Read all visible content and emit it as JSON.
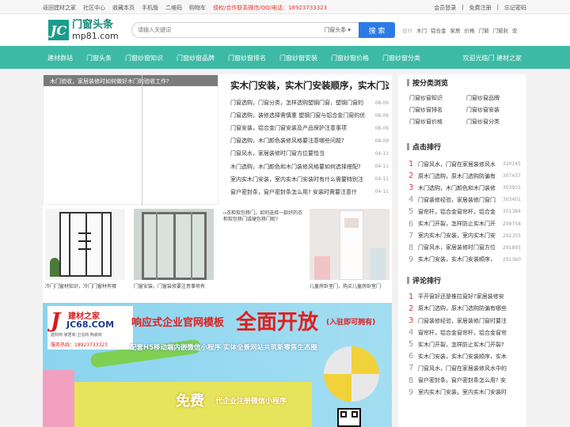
{
  "topbar": {
    "left_links": [
      "返回建材之家",
      "社区中心",
      "收藏本页",
      "手机版",
      "二维码",
      "购物车"
    ],
    "hotline": "侵权/合作联系微信/QQ/电话：18923733323",
    "right_links": [
      "会员登录",
      "免费注册",
      "忘记密码"
    ]
  },
  "header": {
    "logo_letter": "JC",
    "logo_title": "门窗头条",
    "logo_domain": "mp81.com",
    "search_placeholder": "请输入关键词",
    "search_category": "门窗头条",
    "search_button": "搜 索",
    "hot_links": [
      "建材",
      "木门",
      "铝合金",
      "家居",
      "价格",
      "门窗",
      "门窗封",
      "安"
    ]
  },
  "nav": {
    "items": [
      "建材群站",
      "门窗头条",
      "门窗纱窗知识",
      "门窗纱窗品牌",
      "门窗纱窗排名",
      "门窗纱窗安装",
      "门窗纱窗价格",
      "门窗纱窗分类"
    ],
    "welcome": "欢迎光临门 建材之家"
  },
  "slider": {
    "caption": "木门验收，家居装修时如何做好木门的验收工作?"
  },
  "news": {
    "headline": "实木门安装，实木门安装顺序，实木门选",
    "items": [
      {
        "title": "门窗选购，门窗分类，怎样选购塑钢门窗，塑钢门窗的",
        "date": "08-09"
      },
      {
        "title": "门窗选购，装修选择需慎重 塑钢门窗与铝合金门窗的优",
        "date": "08-09"
      },
      {
        "title": "门窗安装，铝合金门窗安装及产品保护注意事项",
        "date": "08-09"
      },
      {
        "title": "门窗选购，木门颜色装修风格要注意哪些问题?",
        "date": "08-09"
      },
      {
        "title": "门窗风水，家居装修时门窗方位要恰当",
        "date": "04-11"
      },
      {
        "title": "木门选购，木门颜色和木门装修风格要如何选择搭配?",
        "date": "04-11"
      },
      {
        "title": "室内实木门安装，室内实木门安装时有什么需要特别注",
        "date": "04-11"
      },
      {
        "title": "窗户密封条，窗户密封条怎么用? 安装时需要注意什",
        "date": "04-11"
      }
    ]
  },
  "thumbs": [
    {
      "caption": "冷门门窗材知识，冷门门窗材有哪"
    },
    {
      "caption": "门窗安装，门窗装修要注意事项有"
    },
    {
      "caption": "衣柜软包移门，如何选择一款好的衣柜软包移门?",
      "alt": "衣柜软包移门，如何选择一款好的衣柜软包移门或硬包移门呢?"
    },
    {
      "caption": "儿童房卧室门，购买儿童房卧室门"
    }
  ],
  "banner": {
    "brand": "建材之家",
    "brand_domain": "JC68.COM",
    "brand_sub": "建材商·家居商·卫浴商·陶瓷商",
    "brand_phone": "服务热线：18923733323",
    "headline_left": "响应式企业官网模板",
    "headline_main": "全面开放",
    "headline_tag": "(入驻即可拥有)",
    "subline": "配套H5移动端内嵌微信小程序 实体全景网站共筑新零售生态圈",
    "free_big": "免费",
    "free_text": "代企业注册微信小程序"
  },
  "sidebar": {
    "cat_title": "按分类浏览",
    "categories": [
      "门窗纱窗知识",
      "门窗纱窗品牌",
      "门窗纱窗排名",
      "门窗纱窗安装",
      "门窗纱窗价格",
      "门窗纱窗分类"
    ],
    "rank_title": "点击排行",
    "rank": [
      {
        "n": "1",
        "title": "门窗风水，门窗在家居装修风水",
        "count": "320145"
      },
      {
        "n": "2",
        "title": "原木门选购，原木门选购防骗有",
        "count": "307437"
      },
      {
        "n": "3",
        "title": "木门选购，木门颜色和木门装修",
        "count": "303931"
      },
      {
        "n": "4",
        "title": "门窗装修经验，家居装修门窗门",
        "count": "303401"
      },
      {
        "n": "5",
        "title": "窗帘杆，铝合金窗帘杆，铝合金",
        "count": "301384"
      },
      {
        "n": "6",
        "title": "实木门开裂，怎样防止实木门开",
        "count": "299758"
      },
      {
        "n": "7",
        "title": "室内实木门安装，室内实木门安",
        "count": "292355"
      },
      {
        "n": "8",
        "title": "门窗风水，家居装修时门窗方位",
        "count": "291895"
      },
      {
        "n": "9",
        "title": "实木门安装，实木门安装顺序，",
        "count": "291360"
      }
    ],
    "comment_title": "评论排行",
    "comments": [
      {
        "n": "1",
        "title": "平开窗好还是推拉窗好?家居装修安"
      },
      {
        "n": "2",
        "title": "原木门选购，原木门选购防骗有哪些"
      },
      {
        "n": "3",
        "title": "门窗装修经验，家居装修门窗时要注"
      },
      {
        "n": "4",
        "title": "窗帘杆，铝合金窗帘杆，铝合金窗帘"
      },
      {
        "n": "5",
        "title": "实木门开裂，怎样防止实木门开裂?"
      },
      {
        "n": "6",
        "title": "实木门安装，实木门安装顺序，实木"
      },
      {
        "n": "7",
        "title": "门窗风水，门窗在家居装修风水中的"
      },
      {
        "n": "8",
        "title": "窗户密封条，窗户密封条怎么用? 安"
      },
      {
        "n": "9",
        "title": "室内实木门安装，室内实木门安装时"
      }
    ]
  }
}
